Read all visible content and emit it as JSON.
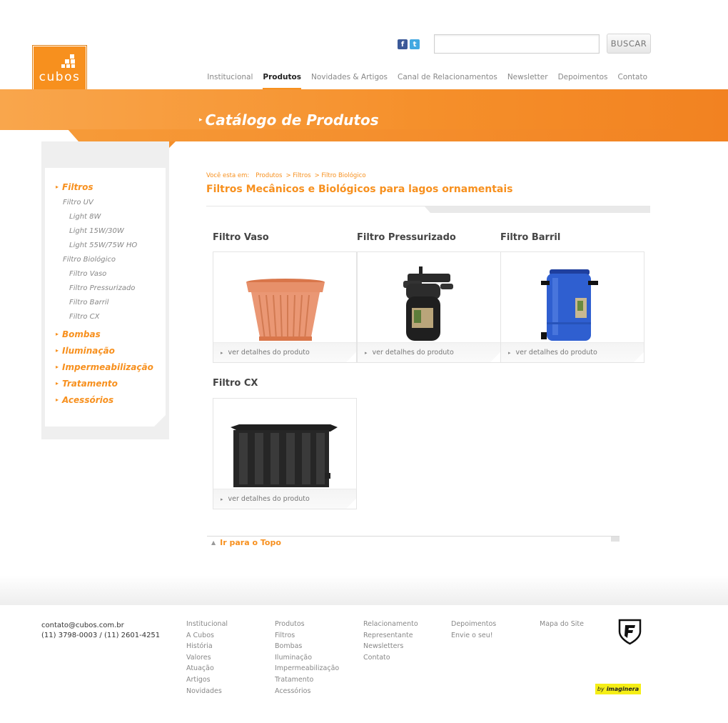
{
  "brand": {
    "name": "cubos"
  },
  "header": {
    "search_button": "BUSCAR",
    "search_value": ""
  },
  "nav": [
    {
      "label": "Institucional",
      "active": false
    },
    {
      "label": "Produtos",
      "active": true
    },
    {
      "label": "Novidades & Artigos",
      "active": false
    },
    {
      "label": "Canal de Relacionamentos",
      "active": false
    },
    {
      "label": "Newsletter",
      "active": false
    },
    {
      "label": "Depoimentos",
      "active": false
    },
    {
      "label": "Contato",
      "active": false
    }
  ],
  "page_title": "Catálogo de Produtos",
  "sidebar": {
    "filtros": "Filtros",
    "filtro_uv": "Filtro UV",
    "uv_items": [
      "Light 8W",
      "Light 15W/30W",
      "Light 55W/75W HO"
    ],
    "filtro_bio": "Filtro Biológico",
    "bio_items": [
      "Filtro Vaso",
      "Filtro Pressurizado",
      "Filtro Barril",
      "Filtro CX"
    ],
    "categories": [
      "Bombas",
      "Iluminação",
      "Impermeabilização",
      "Tratamento",
      "Acessórios"
    ]
  },
  "breadcrumb": {
    "label": "Você esta em:",
    "items": [
      "Produtos",
      "> Filtros",
      "> Filtro Biológico"
    ]
  },
  "heading": "Filtros Mecânicos e Biológicos para lagos ornamentais",
  "products": [
    {
      "title": "Filtro Vaso",
      "link": "ver detalhes do produto"
    },
    {
      "title": "Filtro Pressurizado",
      "link": "ver detalhes do produto"
    },
    {
      "title": "Filtro Barril",
      "link": "ver detalhes do produto"
    },
    {
      "title": "Filtro CX",
      "link": "ver detalhes do produto"
    }
  ],
  "go_top": "Ir para o Topo",
  "footer": {
    "email": "contato@cubos.com.br",
    "phones": "(11) 3798-0003 / (11) 2601-4251",
    "col1": [
      "Institucional",
      "A Cubos",
      "História",
      "Valores",
      "Atuação",
      "Artigos",
      "Novidades"
    ],
    "col2": [
      "Produtos",
      "Filtros",
      "Bombas",
      "Iluminação",
      "Impermeabilização",
      "Tratamento",
      "Acessórios"
    ],
    "col3": [
      "Relacionamento",
      "Representante",
      "Newsletters",
      "Contato"
    ],
    "col4": [
      "Depoimentos",
      "Envie o seu!"
    ],
    "col5": [
      "Mapa do Site"
    ],
    "credit_by": "by",
    "credit_name": "imaginera"
  },
  "colors": {
    "accent": "#f7901e"
  }
}
